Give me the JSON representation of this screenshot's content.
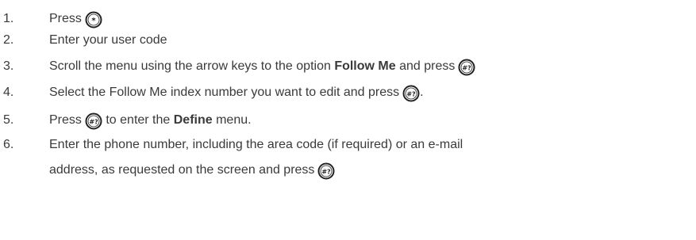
{
  "steps": [
    {
      "number": "1.",
      "text_before": "Press",
      "icon": "star-key-icon",
      "icon_glyph": "*"
    },
    {
      "number": "2.",
      "text": "Enter your user code"
    },
    {
      "number": "3.",
      "text_before": "Scroll the menu using the arrow keys to the option ",
      "bold": "Follow Me",
      "text_after": " and press",
      "icon": "hash-question-key-icon",
      "icon_glyph": "#?"
    },
    {
      "number": "4.",
      "text_before": "Select the Follow Me index number you want to edit and press",
      "icon": "hash-question-key-icon",
      "icon_glyph": "#?",
      "text_end": "."
    },
    {
      "number": "5.",
      "text_before": "Press",
      "icon": "hash-question-key-icon",
      "icon_glyph": "#?",
      "text_mid": " to enter the ",
      "bold": "Define",
      "text_after": " menu."
    },
    {
      "number": "6.",
      "text_line1": "Enter the phone number, including the area code (if required) or an e-mail",
      "text_line2": "address, as requested on the screen and press",
      "icon": "hash-question-key-icon",
      "icon_glyph": "#?"
    }
  ]
}
